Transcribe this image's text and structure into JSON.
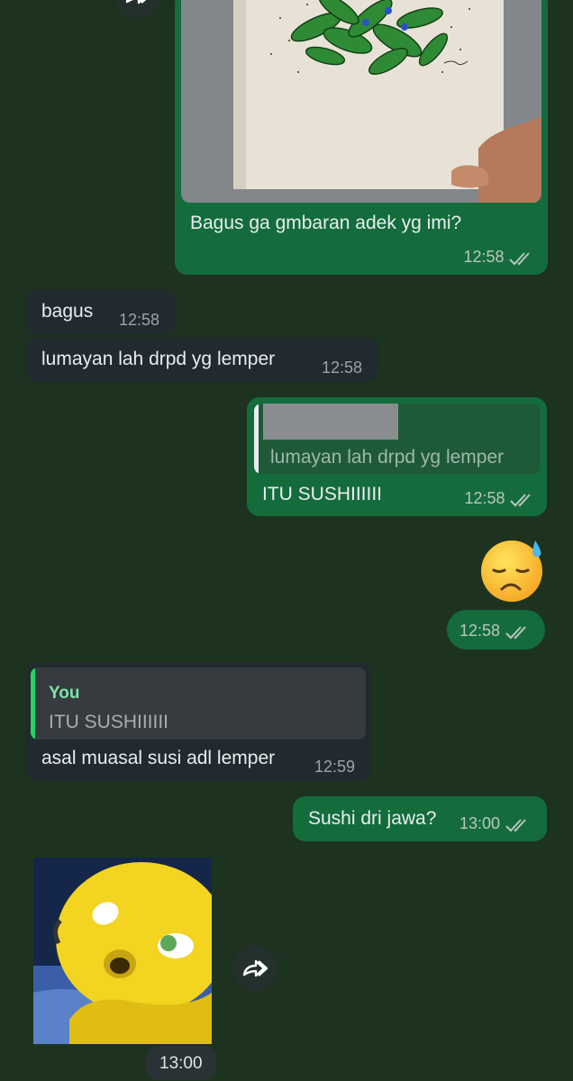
{
  "chat": {
    "messages": [
      {
        "id": "m1",
        "direction": "out",
        "type": "image",
        "caption": "Bagus ga gmbaran adek yg imi?",
        "time": "12:58",
        "status": "read"
      },
      {
        "id": "m2",
        "direction": "in",
        "text": "bagus",
        "time": "12:58"
      },
      {
        "id": "m3",
        "direction": "in",
        "text": "lumayan lah drpd yg lemper",
        "time": "12:58"
      },
      {
        "id": "m4",
        "direction": "out",
        "quote": {
          "author": "",
          "text": "lumayan lah drpd yg lemper"
        },
        "text": "ITU SUSHIIIIII",
        "time": "12:58",
        "status": "read"
      },
      {
        "id": "m5",
        "direction": "out",
        "type": "emoji",
        "emoji": "😓",
        "time": "12:58",
        "status": "read"
      },
      {
        "id": "m6",
        "direction": "in",
        "quote": {
          "author": "You",
          "text": "ITU SUSHIIIIII"
        },
        "text": "asal muasal susi adl lemper",
        "time": "12:59"
      },
      {
        "id": "m7",
        "direction": "out",
        "text": "Sushi dri jawa?",
        "time": "13:00",
        "status": "read"
      },
      {
        "id": "m8",
        "direction": "in",
        "type": "image",
        "time": "13:00"
      }
    ]
  },
  "colors": {
    "background": "#1d3320",
    "outgoing_bubble": "#146c3c",
    "incoming_bubble": "#212a2f",
    "quote_accent_you": "#25d366",
    "quote_author_you": "#7ee3a5"
  },
  "icons": {
    "forward": "forward-icon",
    "read_ticks": "double-check-icon"
  }
}
